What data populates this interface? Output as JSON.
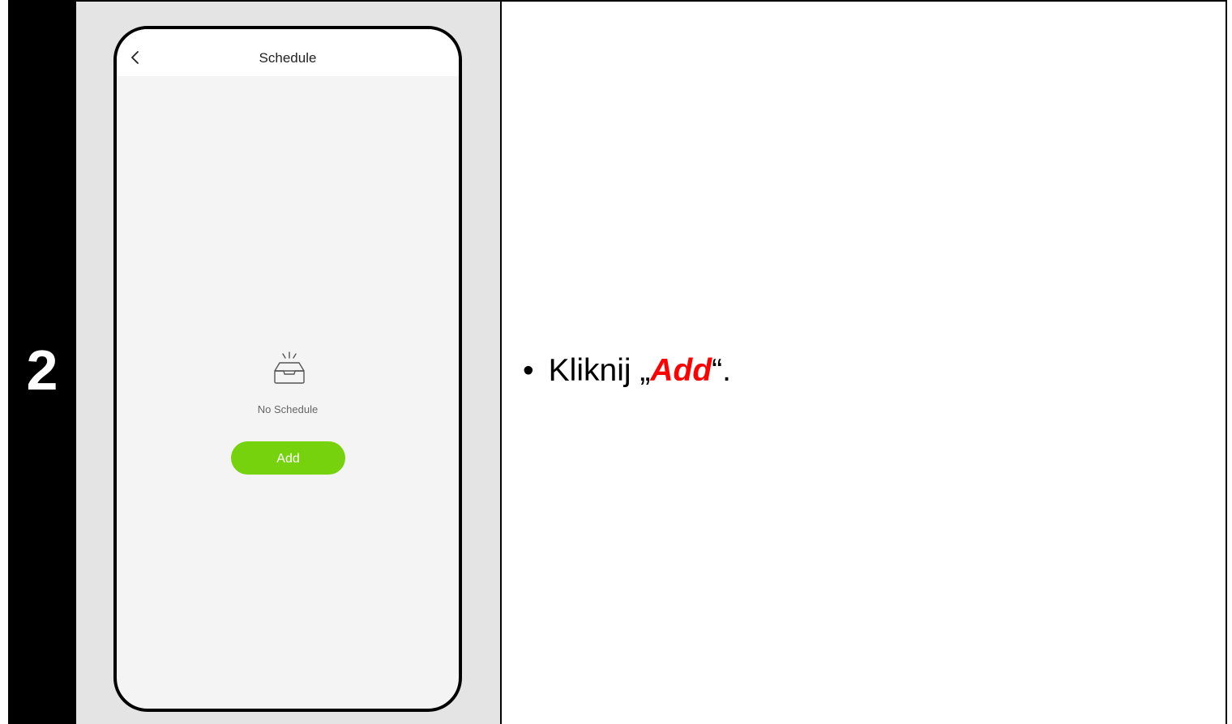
{
  "step": {
    "number": "2"
  },
  "phone": {
    "nav_title": "Schedule",
    "back_icon": "chevron-left-icon",
    "empty_icon": "empty-tray-icon",
    "empty_text": "No Schedule",
    "add_label": "Add",
    "accent_color": "#76d20d"
  },
  "instruction": {
    "bullet": "•",
    "prefix": "Kliknij „",
    "highlight": "Add",
    "suffix": "“.",
    "highlight_color": "#ff0000"
  }
}
